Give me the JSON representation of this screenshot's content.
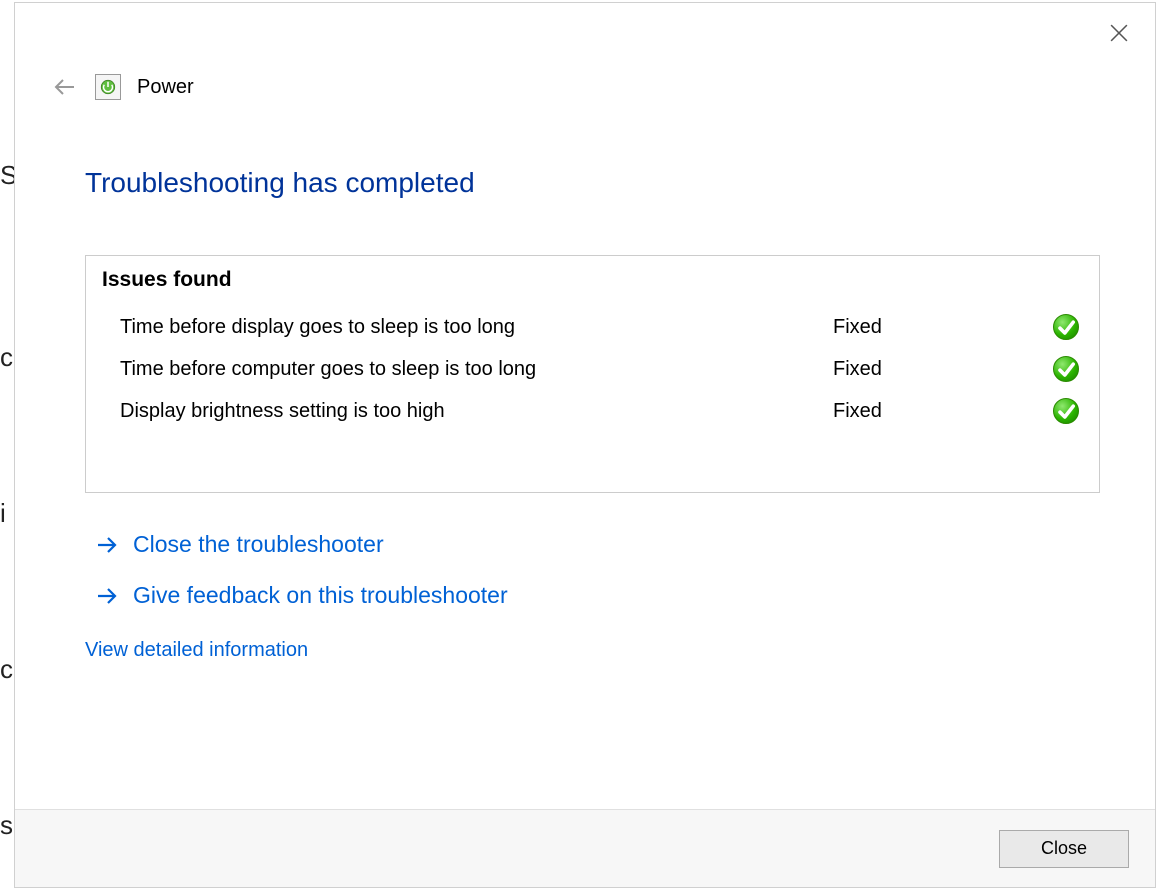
{
  "header": {
    "title": "Power"
  },
  "main": {
    "title": "Troubleshooting has completed",
    "issues_heading": "Issues found",
    "issues": [
      {
        "description": "Time before display goes to sleep is too long",
        "status": "Fixed"
      },
      {
        "description": "Time before computer goes to sleep is too long",
        "status": "Fixed"
      },
      {
        "description": "Display brightness setting is too high",
        "status": "Fixed"
      }
    ],
    "actions": {
      "close_troubleshooter": "Close the troubleshooter",
      "give_feedback": "Give feedback on this troubleshooter"
    },
    "detail_link": "View detailed information"
  },
  "footer": {
    "close_label": "Close"
  }
}
